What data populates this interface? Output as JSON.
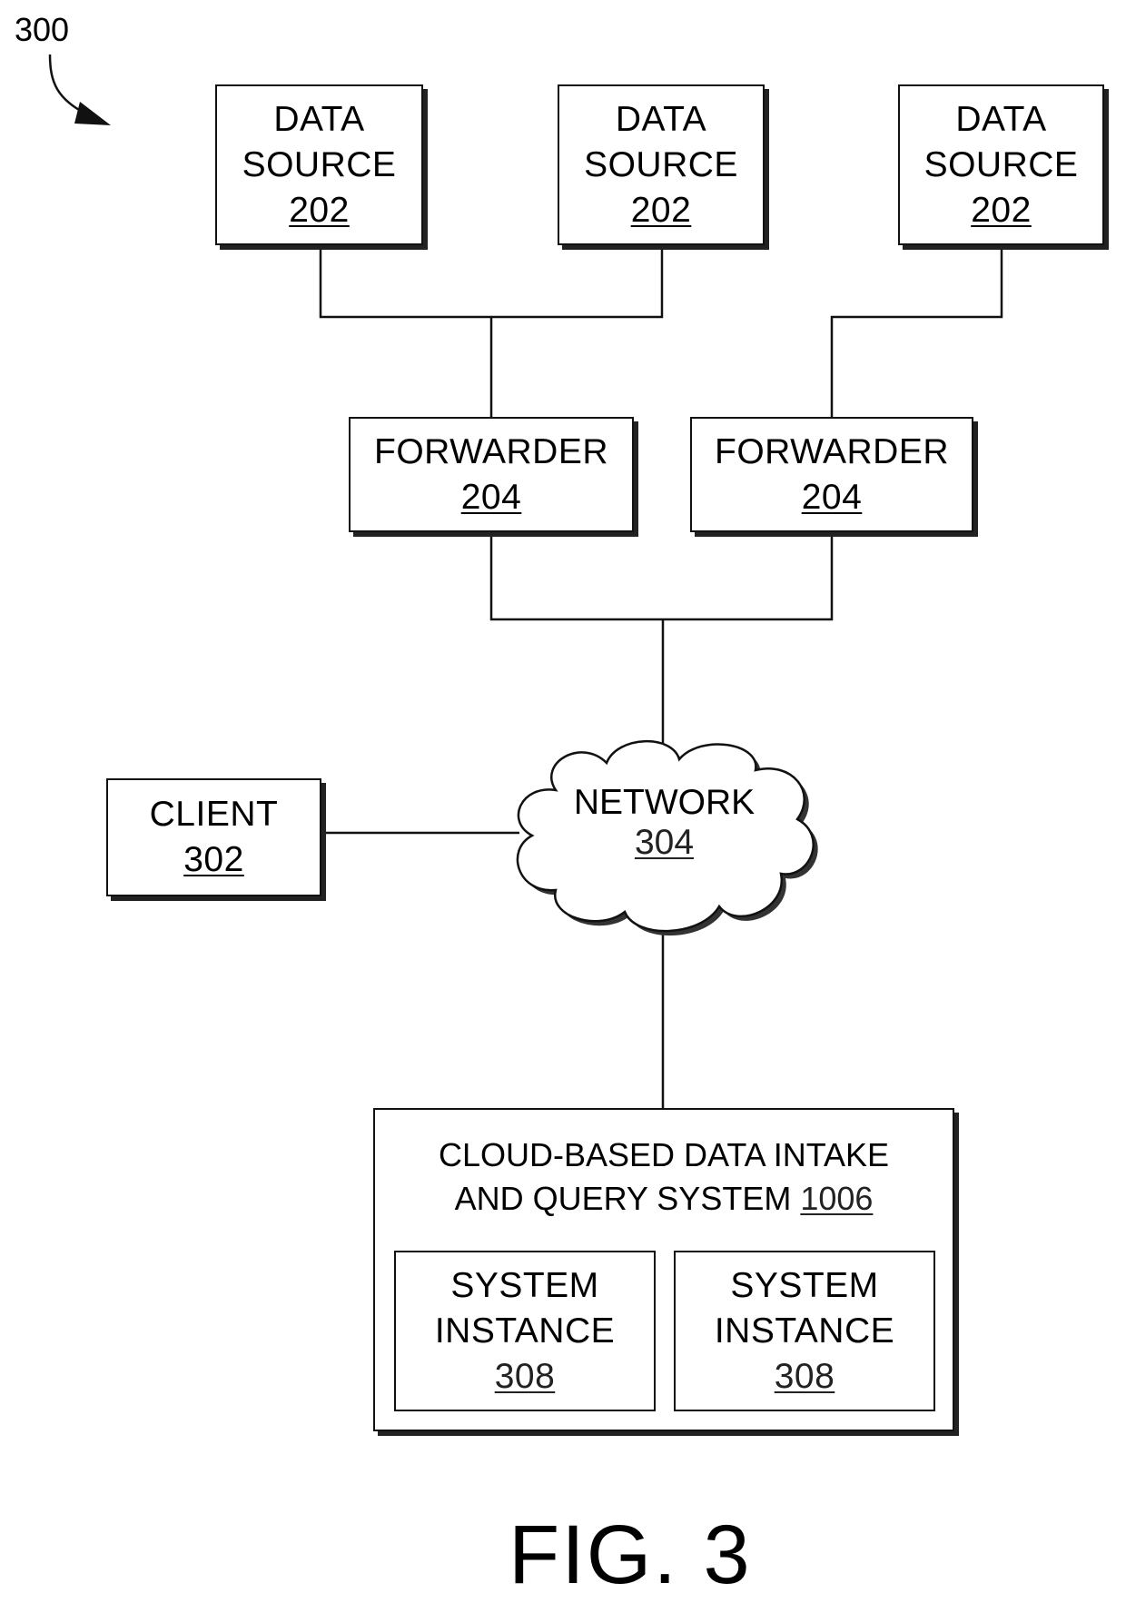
{
  "figure": {
    "reference": "300",
    "caption": "FIG. 3"
  },
  "data_sources": [
    {
      "line1": "DATA",
      "line2": "SOURCE",
      "ref": "202"
    },
    {
      "line1": "DATA",
      "line2": "SOURCE",
      "ref": "202"
    },
    {
      "line1": "DATA",
      "line2": "SOURCE",
      "ref": "202"
    }
  ],
  "forwarders": [
    {
      "label": "FORWARDER",
      "ref": "204"
    },
    {
      "label": "FORWARDER",
      "ref": "204"
    }
  ],
  "client": {
    "label": "CLIENT",
    "ref": "302"
  },
  "network": {
    "label": "NETWORK",
    "ref": "304"
  },
  "system": {
    "line1": "CLOUD-BASED DATA INTAKE",
    "line2": "AND QUERY SYSTEM",
    "ref": "1006",
    "instances": [
      {
        "line1": "SYSTEM",
        "line2": "INSTANCE",
        "ref": "308"
      },
      {
        "line1": "SYSTEM",
        "line2": "INSTANCE",
        "ref": "308"
      }
    ]
  },
  "colors": {
    "line": "#111111",
    "background": "#ffffff"
  }
}
